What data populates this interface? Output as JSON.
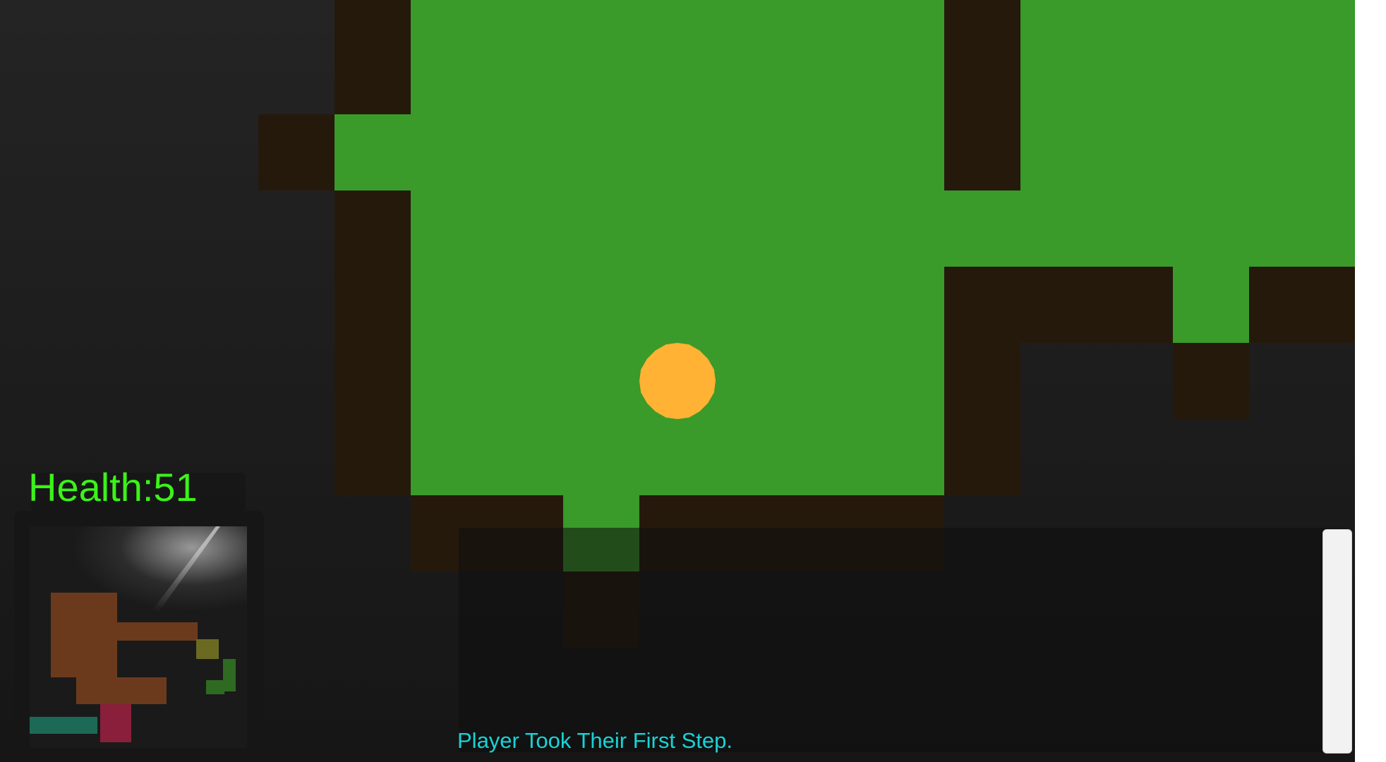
{
  "hud": {
    "health_text": "Health:51",
    "health_color": "#3cf21a"
  },
  "log": {
    "messages": [
      "Player Took Their First Step."
    ],
    "text_color": "#19d3d6"
  },
  "colors": {
    "floor": "#3a9a2a",
    "wall": "#25190c",
    "player": "#ffb233",
    "background": "#1c1c1c"
  },
  "icons": {
    "player": "player-token-icon",
    "minimap": "minimap-icon"
  }
}
